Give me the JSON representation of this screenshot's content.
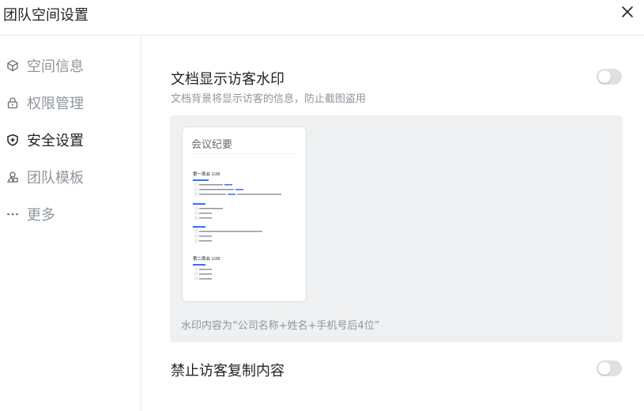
{
  "dialog": {
    "title": "团队空间设置"
  },
  "sidebar": {
    "items": [
      {
        "label": "空间信息",
        "icon": "cube-icon",
        "active": false
      },
      {
        "label": "权限管理",
        "icon": "lock-icon",
        "active": false
      },
      {
        "label": "安全设置",
        "icon": "shield-icon",
        "active": true
      },
      {
        "label": "团队模板",
        "icon": "template-icon",
        "active": false
      },
      {
        "label": "更多",
        "icon": "more-icon",
        "active": false
      }
    ]
  },
  "settings": {
    "watermark": {
      "title": "文档显示访客水印",
      "description": "文档背景将显示访客的信息，防止截图盗用",
      "enabled": false
    },
    "preview": {
      "doc_title": "会议纪要",
      "caption": "水印内容为“公司名称+姓名+手机号后4位”",
      "section1": "第一周会 1/28",
      "section2": "第二周会 1/28"
    },
    "copy": {
      "title": "禁止访客复制内容",
      "enabled": false
    }
  },
  "colors": {
    "toggle_off": "#dee0e3",
    "accent_blue": "#3370ff",
    "text_primary": "#1f2329",
    "text_secondary": "#8f959e",
    "preview_bg": "#eff0f1"
  }
}
